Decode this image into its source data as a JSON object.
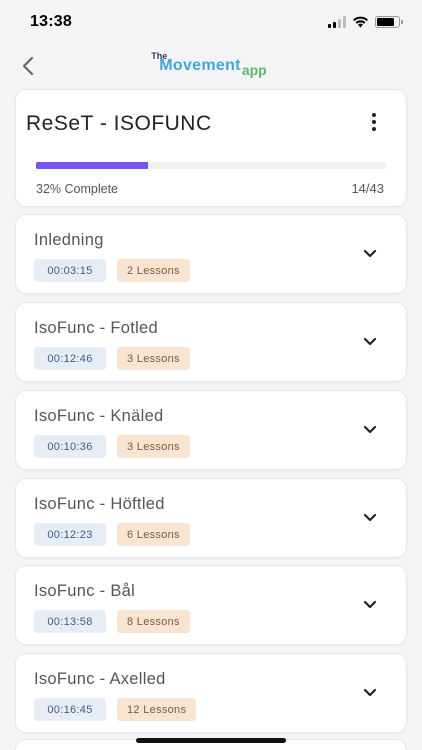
{
  "status_bar": {
    "time": "13:38"
  },
  "header": {
    "logo_the": "The",
    "logo_movement": "Movement",
    "logo_app": "app"
  },
  "course": {
    "title": "ReSeT - ISOFUNC",
    "progress_percent": 32,
    "progress_label": "32% Complete",
    "progress_count": "14/43"
  },
  "sections": [
    {
      "title": "Inledning",
      "duration": "00:03:15",
      "lessons": "2 Lessons"
    },
    {
      "title": "IsoFunc - Fotled",
      "duration": "00:12:46",
      "lessons": "3 Lessons"
    },
    {
      "title": "IsoFunc - Knäled",
      "duration": "00:10:36",
      "lessons": "3 Lessons"
    },
    {
      "title": "IsoFunc - Höftled",
      "duration": "00:12:23",
      "lessons": "6 Lessons"
    },
    {
      "title": "IsoFunc - Bål",
      "duration": "00:13:58",
      "lessons": "8 Lessons"
    },
    {
      "title": "IsoFunc - Axelled",
      "duration": "00:16:45",
      "lessons": "12 Lessons"
    }
  ],
  "colors": {
    "progress_fill": "#7b52f0",
    "duration_chip_bg": "#e6edf6",
    "lessons_chip_bg": "#f9e4d2",
    "logo_movement": "#3fa8d6",
    "logo_app": "#5db86a"
  },
  "icons": {
    "back": "chevron-left-icon",
    "more": "more-vertical-icon",
    "expand": "chevron-down-icon"
  }
}
